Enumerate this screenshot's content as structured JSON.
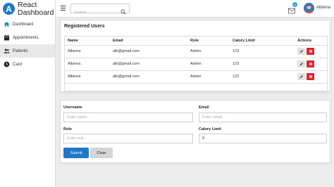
{
  "brand": {
    "line1": "React",
    "line2": "Dashboard"
  },
  "sidebar": {
    "items": [
      {
        "label": "Dashboard",
        "icon": "home-icon",
        "active": false
      },
      {
        "label": "Appointments",
        "icon": "calendar-icon",
        "active": false
      },
      {
        "label": "Patients",
        "icon": "users-icon",
        "active": true
      },
      {
        "label": "Card",
        "icon": "clock-icon",
        "active": false
      }
    ]
  },
  "topbar": {
    "search_placeholder": "Search...",
    "mail_badge": "3",
    "user_name": "Albiona"
  },
  "users_table": {
    "title": "Registered Users",
    "headers": [
      "Name",
      "Email",
      "Role",
      "Calory Limit",
      "Actions"
    ],
    "rows": [
      [
        "Albiona",
        "alb@gmail.com",
        "Admin",
        "123"
      ],
      [
        "Albiona",
        "alb@gmail.com",
        "Admin",
        "123"
      ],
      [
        "Albiona",
        "alb@gmail.com",
        "Admin",
        "123"
      ]
    ]
  },
  "form": {
    "username_label": "Username",
    "username_placeholder": "Enter name...",
    "email_label": "Email",
    "email_placeholder": "Enter email...",
    "role_label": "Role",
    "role_placeholder": "Enter role...",
    "calory_label": "Calory Limit",
    "calory_value": "0",
    "submit_label": "Submit",
    "clear_label": "Clear"
  },
  "colors": {
    "primary": "#1f78c8",
    "danger": "#d9232d",
    "badge": "#29a8e0"
  }
}
